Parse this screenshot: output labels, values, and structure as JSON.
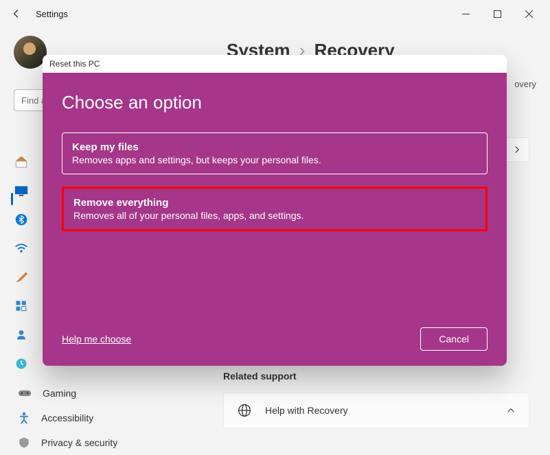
{
  "titlebar": {
    "title": "Settings"
  },
  "search": {
    "placeholder": "Find a setting"
  },
  "breadcrumb": {
    "parent": "System",
    "current": "Recovery"
  },
  "partial": "overy",
  "sidebar": {
    "items": [
      {
        "label": "Gaming"
      },
      {
        "label": "Accessibility"
      },
      {
        "label": "Privacy & security"
      }
    ]
  },
  "related": {
    "heading": "Related support",
    "help": "Help with Recovery"
  },
  "dialog": {
    "window_title": "Reset this PC",
    "heading": "Choose an option",
    "options": [
      {
        "title": "Keep my files",
        "desc": "Removes apps and settings, but keeps your personal files."
      },
      {
        "title": "Remove everything",
        "desc": "Removes all of your personal files, apps, and settings."
      }
    ],
    "help_link": "Help me choose",
    "cancel": "Cancel"
  }
}
